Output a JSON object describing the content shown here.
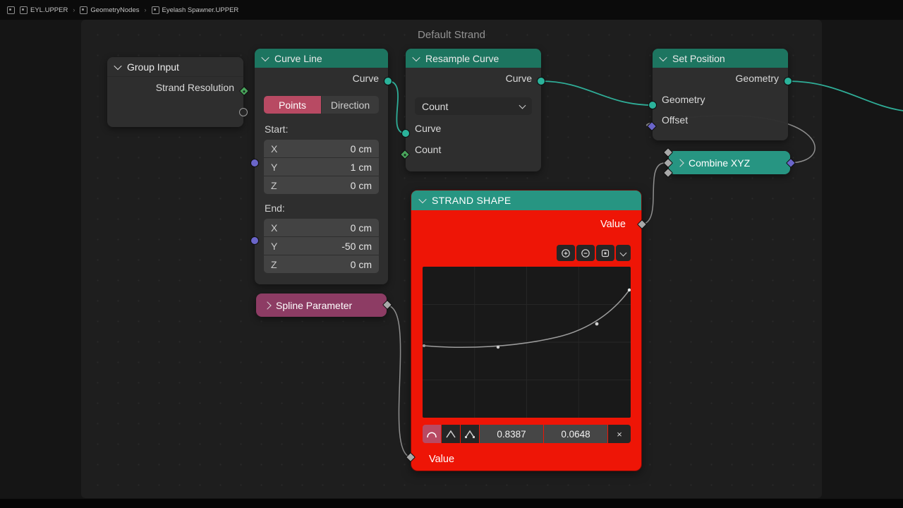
{
  "topbar": {
    "breadcrumb": [
      {
        "label": "EYL.UPPER"
      },
      {
        "label": "GeometryNodes"
      },
      {
        "label": "Eyelash Spawner.UPPER"
      }
    ],
    "separator": "›"
  },
  "editor": {
    "title": "Default Strand"
  },
  "nodes": {
    "group_input": {
      "title": "Group Input",
      "output_label": "Strand Resolution"
    },
    "curve_line": {
      "title": "Curve Line",
      "output_label": "Curve",
      "mode_points": "Points",
      "mode_direction": "Direction",
      "start_label": "Start:",
      "end_label": "End:",
      "start": [
        {
          "axis": "X",
          "value": "0 cm"
        },
        {
          "axis": "Y",
          "value": "1 cm"
        },
        {
          "axis": "Z",
          "value": "0 cm"
        }
      ],
      "end": [
        {
          "axis": "X",
          "value": "0 cm"
        },
        {
          "axis": "Y",
          "value": "-50 cm"
        },
        {
          "axis": "Z",
          "value": "0 cm"
        }
      ]
    },
    "resample_curve": {
      "title": "Resample Curve",
      "output_label": "Curve",
      "mode_dropdown": "Count",
      "input_curve": "Curve",
      "input_count": "Count"
    },
    "set_position": {
      "title": "Set Position",
      "output_label": "Geometry",
      "input_geometry": "Geometry",
      "input_offset": "Offset"
    },
    "combine_xyz": {
      "title": "Combine XYZ"
    },
    "spline_parameter": {
      "title": "Spline Parameter"
    },
    "strand_shape": {
      "title": "STRAND SHAPE",
      "output_label": "Value",
      "input_label": "Value",
      "point_x": "0.8387",
      "point_y": "0.0648",
      "delete_label": "×"
    }
  },
  "colors": {
    "header_green": "#1d7560",
    "header_teal": "#279582",
    "header_mauve": "#8d3c64",
    "selected_node_red": "#ee1506",
    "accent_pink": "#b84a63",
    "socket_teal": "#2bb39b",
    "socket_green": "#49a35b",
    "socket_purple": "#6a65c9",
    "socket_gray": "#a8a8a8",
    "wire_teal": "#2fae98",
    "wire_gray": "#8f8f8f"
  }
}
